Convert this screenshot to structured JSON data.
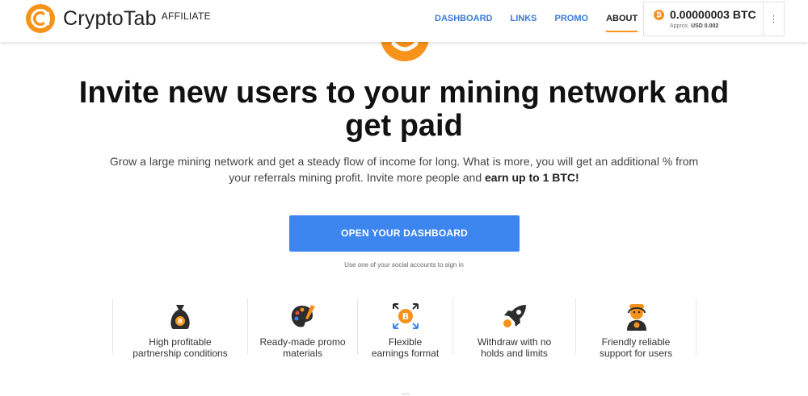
{
  "brand": {
    "name": "CryptoTab",
    "sub": "AFFILIATE",
    "color": "#f7931a"
  },
  "nav": {
    "items": [
      "DASHBOARD",
      "LINKS",
      "PROMO",
      "ABOUT"
    ],
    "active": "ABOUT",
    "link_color": "#3a7bd5"
  },
  "wallet": {
    "coin_icon": "bitcoin-icon",
    "balance": "0.00000003 BTC",
    "approx_label": "Approx.",
    "approx_value": "USD 0.002",
    "menu_icon": "more-vertical-icon"
  },
  "hero": {
    "headline_line1": "Invite new users to your mining network and",
    "headline_line2": "get paid",
    "subtext": "Grow a large mining network and get a steady flow of income for long. What is more, you will get an additional % from your referrals mining profit. Invite more people and ",
    "subtext_bold": "earn up to 1 BTC!",
    "cta_label": "OPEN YOUR DASHBOARD",
    "cta_color": "#3d86f0",
    "hint": "Use one of your social accounts to sign in"
  },
  "features": [
    {
      "icon": "money-bag-icon",
      "line1": "High profitable",
      "line2": "partnership conditions"
    },
    {
      "icon": "palette-icon",
      "line1": "Ready-made promo",
      "line2": "materials"
    },
    {
      "icon": "exchange-icon",
      "line1": "Flexible",
      "line2": "earnings format"
    },
    {
      "icon": "rocket-icon",
      "line1": "Withdraw with no",
      "line2": "holds and limits"
    },
    {
      "icon": "support-agent-icon",
      "line1": "Friendly reliable",
      "line2": "support for users"
    }
  ]
}
